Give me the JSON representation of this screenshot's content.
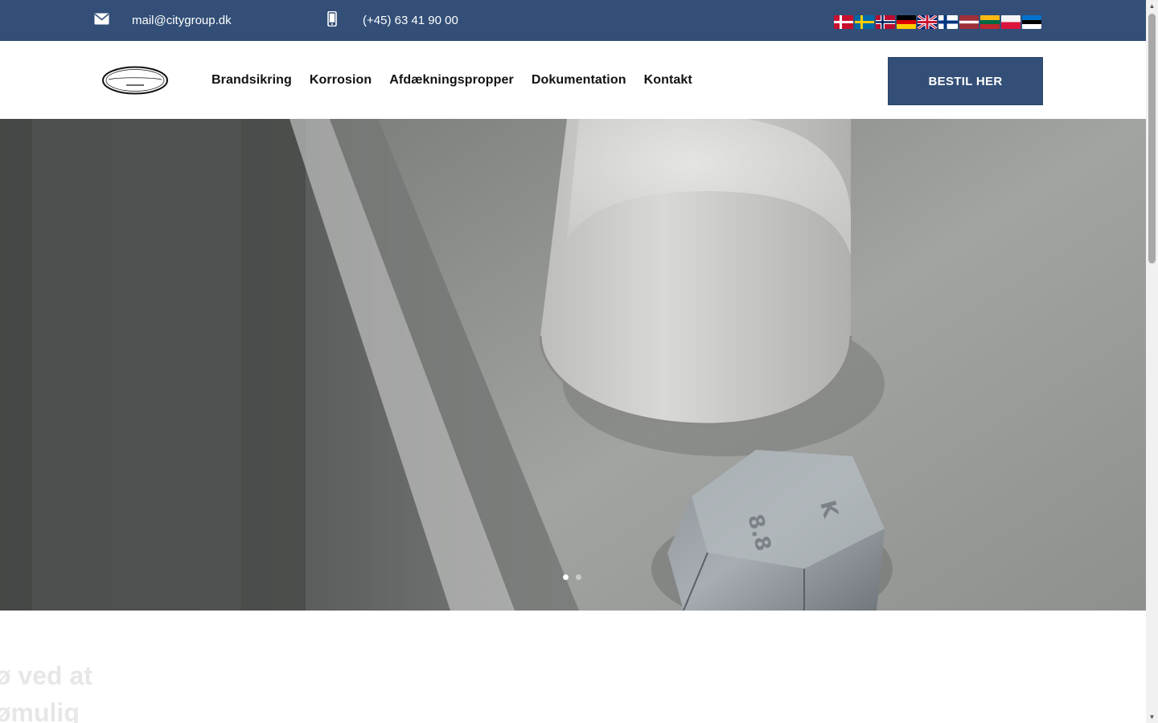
{
  "topbar": {
    "email": "mail@citygroup.dk",
    "phone": "(+45) 63 41 90 00",
    "email_icon": "envelope-icon",
    "phone_icon": "mobile-phone-icon",
    "background": "#334f78"
  },
  "languages": [
    {
      "code": "da",
      "label": "Dansk"
    },
    {
      "code": "sv",
      "label": "Svenska"
    },
    {
      "code": "no",
      "label": "Norsk"
    },
    {
      "code": "de",
      "label": "Deutsch"
    },
    {
      "code": "en",
      "label": "English"
    },
    {
      "code": "fi",
      "label": "Suomi"
    },
    {
      "code": "lv",
      "label": "Latviešu"
    },
    {
      "code": "lt",
      "label": "Lietuvių"
    },
    {
      "code": "pl",
      "label": "Polski"
    },
    {
      "code": "et",
      "label": "Eesti"
    }
  ],
  "header": {
    "logo_text": "CityGroup.dk",
    "nav": [
      "Brandsikring",
      "Korrosion",
      "Afdækningspropper",
      "Dokumentation",
      "Kontakt"
    ],
    "cta_label": "BESTIL HER"
  },
  "hero": {
    "slides_count": 2,
    "active_slide": 1
  },
  "lower": {
    "heading_lines": [
      "ø ved at",
      "ømulig"
    ]
  },
  "colors": {
    "brand_blue": "#334f78",
    "text_dark": "#111111"
  }
}
